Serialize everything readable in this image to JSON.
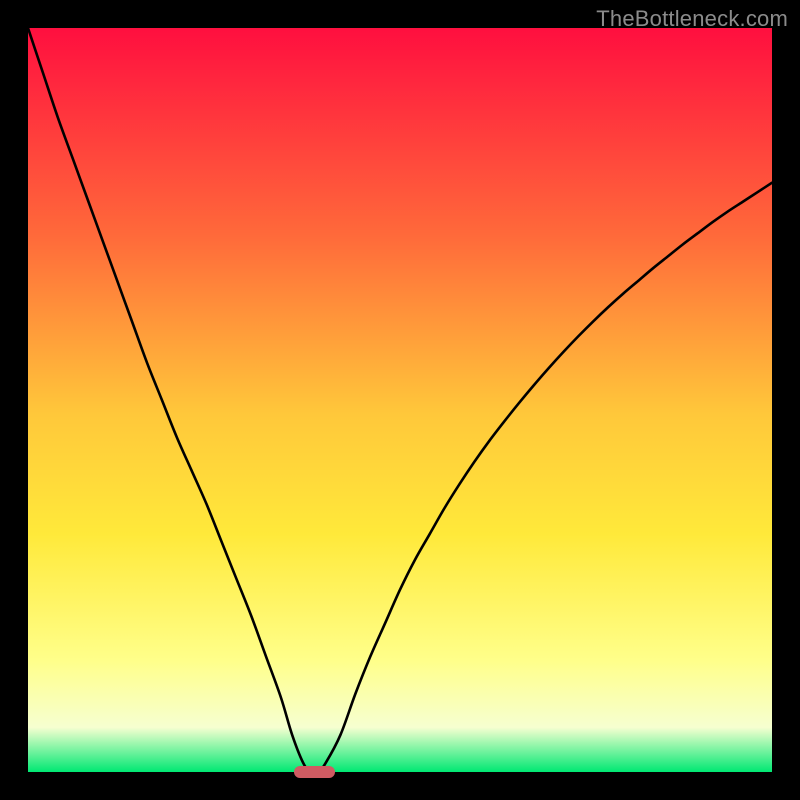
{
  "watermark_text": "TheBottleneck.com",
  "colors": {
    "frame": "#000000",
    "curve": "#000000",
    "marker": "#cf5b62",
    "grad_top": "#ff0f3f",
    "grad_mid1": "#ff6a3a",
    "grad_mid2": "#ffc83a",
    "grad_mid3": "#ffe93a",
    "grad_mid4": "#ffff8a",
    "grad_mid5": "#f6ffd0",
    "grad_bottom": "#00e873"
  },
  "chart_data": {
    "type": "line",
    "title": "",
    "xlabel": "",
    "ylabel": "",
    "xlim": [
      0,
      100
    ],
    "ylim": [
      0,
      100
    ],
    "x": [
      0,
      2,
      4,
      6,
      8,
      10,
      12,
      14,
      16,
      18,
      20,
      22,
      24,
      26,
      28,
      30,
      32,
      34,
      35.5,
      37,
      38,
      39,
      40,
      42,
      44,
      46,
      48,
      50,
      52,
      54,
      56,
      58,
      60,
      62,
      64,
      66,
      68,
      70,
      72,
      74,
      76,
      78,
      80,
      82,
      84,
      86,
      88,
      90,
      92,
      94,
      96,
      98,
      100
    ],
    "y": [
      100,
      94,
      88,
      82.5,
      77,
      71.5,
      66,
      60.5,
      55,
      50,
      45,
      40.5,
      36,
      31,
      26,
      21,
      15.5,
      10,
      5,
      1.2,
      0,
      0,
      1.2,
      5,
      10.5,
      15.5,
      20,
      24.5,
      28.5,
      32,
      35.5,
      38.7,
      41.7,
      44.5,
      47.1,
      49.6,
      52,
      54.3,
      56.5,
      58.6,
      60.6,
      62.5,
      64.3,
      66,
      67.7,
      69.3,
      70.9,
      72.4,
      73.9,
      75.3,
      76.6,
      77.9,
      79.2
    ],
    "min_point": {
      "x": 38.5,
      "y": 0
    },
    "marker": {
      "x_center": 38.5,
      "y": 0,
      "width_pct": 5.5,
      "height_pct": 1.7
    }
  }
}
